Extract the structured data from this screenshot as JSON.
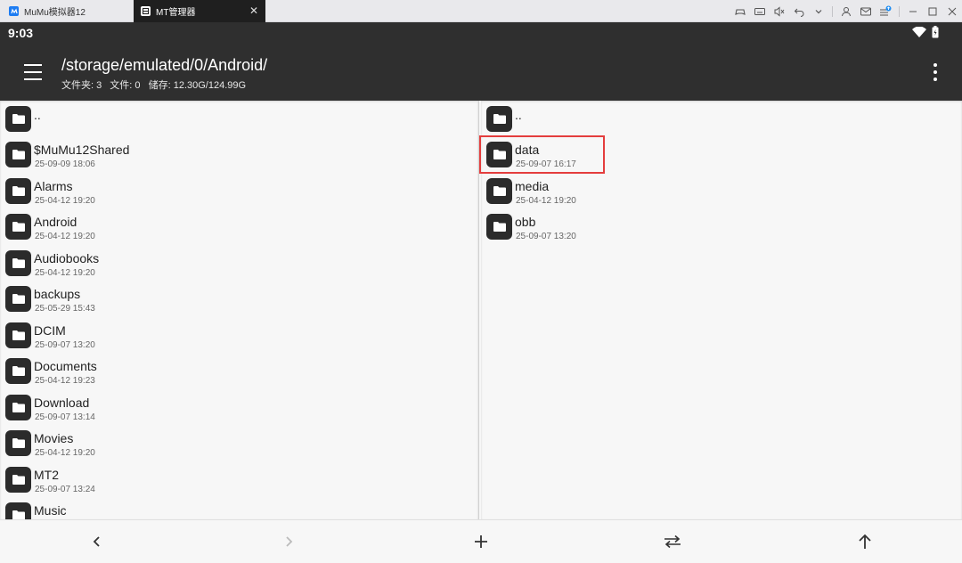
{
  "emulator": {
    "tabs": [
      {
        "label": "MuMu模拟器12"
      },
      {
        "label": "MT管理器"
      }
    ]
  },
  "status_bar": {
    "time": "9:03"
  },
  "header": {
    "path": "/storage/emulated/0/Android/",
    "folders": "文件夹: 3",
    "files": "文件: 0",
    "storage": "储存: 12.30G/124.99G"
  },
  "left_pane": {
    "items": [
      {
        "name": "..",
        "date": ""
      },
      {
        "name": "$MuMu12Shared",
        "date": "25-09-09 18:06"
      },
      {
        "name": "Alarms",
        "date": "25-04-12 19:20"
      },
      {
        "name": "Android",
        "date": "25-04-12 19:20"
      },
      {
        "name": "Audiobooks",
        "date": "25-04-12 19:20"
      },
      {
        "name": "backups",
        "date": "25-05-29 15:43"
      },
      {
        "name": "DCIM",
        "date": "25-09-07 13:20"
      },
      {
        "name": "Documents",
        "date": "25-04-12 19:23"
      },
      {
        "name": "Download",
        "date": "25-09-07 13:14"
      },
      {
        "name": "Movies",
        "date": "25-04-12 19:20"
      },
      {
        "name": "MT2",
        "date": "25-09-07 13:24"
      },
      {
        "name": "Music",
        "date": ""
      }
    ]
  },
  "right_pane": {
    "items": [
      {
        "name": "..",
        "date": ""
      },
      {
        "name": "data",
        "date": "25-09-07 16:17"
      },
      {
        "name": "media",
        "date": "25-04-12 19:20"
      },
      {
        "name": "obb",
        "date": "25-09-07 13:20"
      }
    ]
  },
  "colors": {
    "header_bg": "#2f2f2f",
    "folder_icon_bg": "#2b2b2b",
    "highlight": "#e43d3d",
    "pane_bg": "#f7f7f7"
  }
}
